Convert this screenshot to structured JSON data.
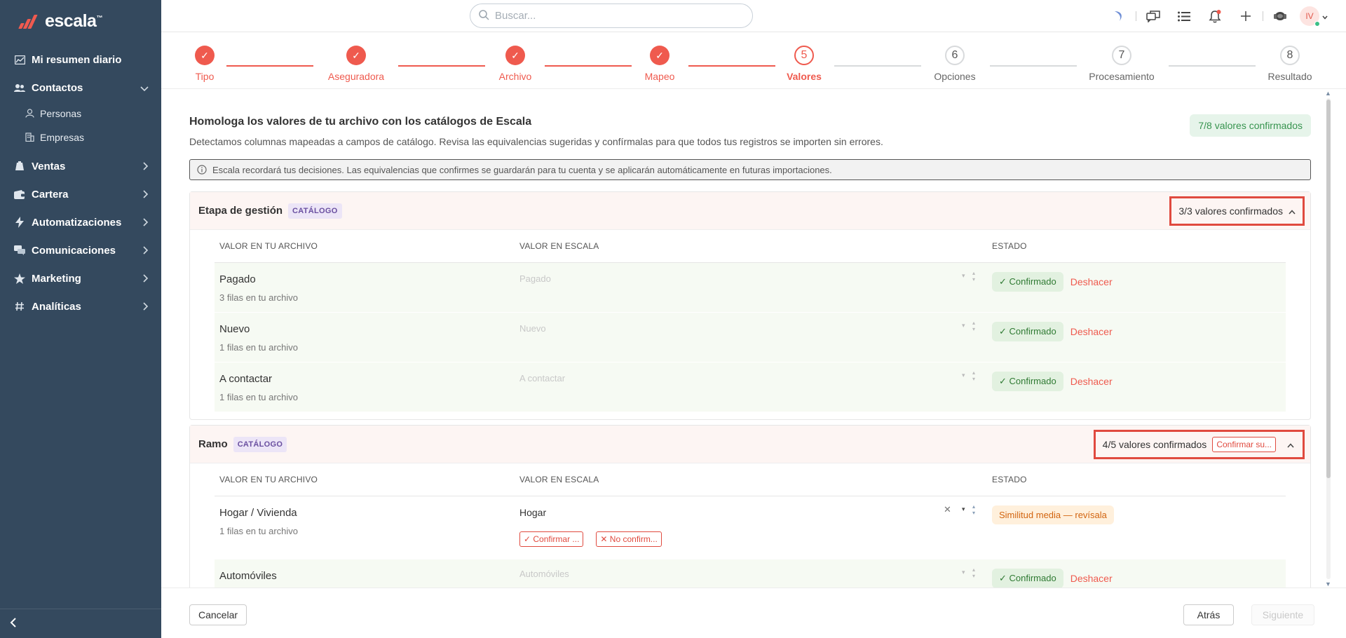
{
  "app": {
    "logo_text": "escala",
    "logo_tm": "™"
  },
  "sidebar": {
    "items": [
      {
        "label": "Mi resumen diario"
      },
      {
        "label": "Contactos"
      },
      {
        "label": "Ventas"
      },
      {
        "label": "Cartera"
      },
      {
        "label": "Automatizaciones"
      },
      {
        "label": "Comunicaciones"
      },
      {
        "label": "Marketing"
      },
      {
        "label": "Analíticas"
      }
    ],
    "subitems": [
      {
        "label": "Personas"
      },
      {
        "label": "Empresas"
      }
    ]
  },
  "topbar": {
    "search_placeholder": "Buscar...",
    "avatar_initials": "IV"
  },
  "stepper": {
    "steps": [
      {
        "num": "✓",
        "label": "Tipo"
      },
      {
        "num": "✓",
        "label": "Aseguradora"
      },
      {
        "num": "✓",
        "label": "Archivo"
      },
      {
        "num": "✓",
        "label": "Mapeo"
      },
      {
        "num": "5",
        "label": "Valores"
      },
      {
        "num": "6",
        "label": "Opciones"
      },
      {
        "num": "7",
        "label": "Procesamiento"
      },
      {
        "num": "8",
        "label": "Resultado"
      }
    ]
  },
  "main": {
    "title": "Homologa los valores de tu archivo con los catálogos de Escala",
    "description": "Detectamos columnas mapeadas a campos de catálogo. Revisa las equivalencias sugeridas y confírmalas para que todos tus registros se importen sin errores.",
    "total_badge": "7/8 valores confirmados",
    "info": "Escala recordará tus decisiones. Las equivalencias que confirmes se guardarán para tu cuenta y se aplicarán automáticamente en futuras importaciones."
  },
  "table_headers": {
    "col1": "VALOR EN TU ARCHIVO",
    "col2": "VALOR EN ESCALA",
    "col3": "ESTADO"
  },
  "sections": [
    {
      "title": "Etapa de gestión",
      "badge": "CATÁLOGO",
      "summary": "3/3 valores confirmados",
      "rows": [
        {
          "name": "Pagado",
          "count": "3 filas en tu archivo",
          "value": "Pagado",
          "status": "✓ Confirmado",
          "action": "Deshacer"
        },
        {
          "name": "Nuevo",
          "count": "1 filas en tu archivo",
          "value": "Nuevo",
          "status": "✓ Confirmado",
          "action": "Deshacer"
        },
        {
          "name": "A contactar",
          "count": "1 filas en tu archivo",
          "value": "A contactar",
          "status": "✓ Confirmado",
          "action": "Deshacer"
        }
      ]
    },
    {
      "title": "Ramo",
      "badge": "CATÁLOGO",
      "summary": "4/5 valores confirmados",
      "summary_button": "Confirmar su...",
      "rows": [
        {
          "name": "Hogar / Vivienda",
          "count": "1 filas en tu archivo",
          "value": "Hogar",
          "status": "Similitud media — revísala",
          "confirm": "✓ Confirmar ...",
          "reject": "✕ No confirm..."
        },
        {
          "name": "Automóviles",
          "value": "Automóviles",
          "status": "✓ Confirmado",
          "action": "Deshacer"
        }
      ]
    }
  ],
  "footer": {
    "cancel": "Cancelar",
    "back": "Atrás",
    "next": "Siguiente"
  },
  "colors": {
    "sidebar": "#34495e",
    "accent": "#ef5a4e",
    "success": "#2f7a33",
    "warning": "#d2640f"
  }
}
